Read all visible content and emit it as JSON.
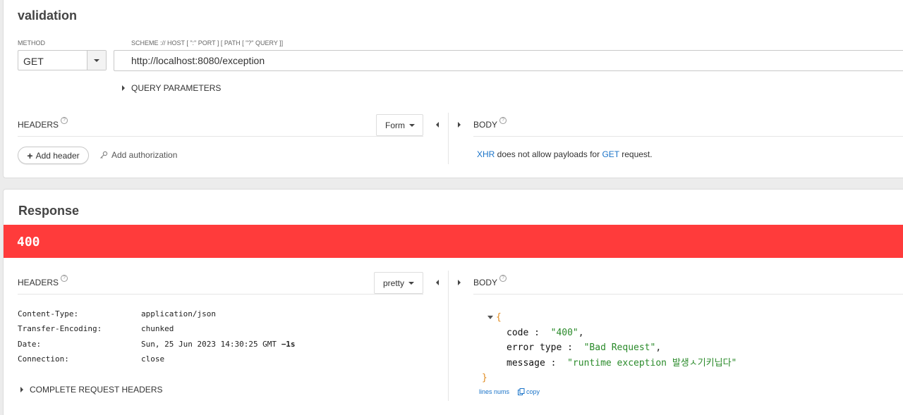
{
  "request": {
    "title": "validation",
    "method_label": "METHOD",
    "method_value": "GET",
    "url_label": "SCHEME :// HOST [ \":\" PORT ] [ PATH [ \"?\" QUERY ]]",
    "url_value": "http://localhost:8080/exception",
    "query_params_label": "QUERY PARAMETERS",
    "headers_label": "HEADERS",
    "headers_mode": "Form",
    "body_label": "BODY",
    "add_header_label": "Add header",
    "add_auth_label": "Add authorization",
    "body_msg_link1": "XHR",
    "body_msg_mid": " does not allow payloads for ",
    "body_msg_link2": "GET",
    "body_msg_end": " request."
  },
  "response": {
    "title": "Response",
    "status_code": "400",
    "status_color": "#ff3b3b",
    "headers_label": "HEADERS",
    "headers_mode": "pretty",
    "body_label": "BODY",
    "headers": [
      {
        "key": "Content-Type:",
        "value": "application/json",
        "suffix": ""
      },
      {
        "key": "Transfer-Encoding:",
        "value": "chunked",
        "suffix": ""
      },
      {
        "key": "Date:",
        "value": "Sun, 25 Jun 2023 14:30:25 GMT ",
        "suffix": "−1s"
      },
      {
        "key": "Connection:",
        "value": "close",
        "suffix": ""
      }
    ],
    "complete_headers_label": "COMPLETE REQUEST HEADERS",
    "json": {
      "open": "{",
      "close": "}",
      "fields": [
        {
          "key": "code",
          "value": "\"400\"",
          "sep": ","
        },
        {
          "key": "error type",
          "value": "\"Bad Request\"",
          "sep": ","
        },
        {
          "key": "message",
          "value": "\"runtime exception 발생ㅅ기키닙다\"",
          "sep": ""
        }
      ]
    },
    "lines_nums_label": "lines nums",
    "copy_label": "copy"
  }
}
